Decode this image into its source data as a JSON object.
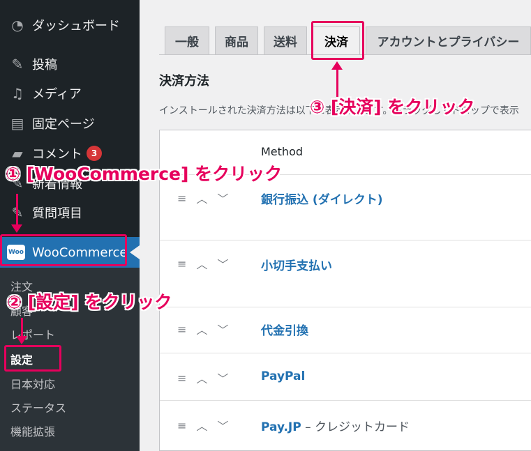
{
  "sidebar": {
    "items": [
      {
        "label": "ダッシュボード",
        "icon": "dashboard-icon"
      },
      {
        "label": "投稿",
        "icon": "pin-icon"
      },
      {
        "label": "メディア",
        "icon": "media-icon"
      },
      {
        "label": "固定ページ",
        "icon": "page-icon"
      },
      {
        "label": "コメント",
        "icon": "comment-icon",
        "badge": "3"
      },
      {
        "label": "新着情報",
        "icon": "pin-icon"
      },
      {
        "label": "質問項目",
        "icon": "pin-icon"
      }
    ],
    "woocommerce": {
      "label": "WooCommerce",
      "logo": "Woo"
    },
    "submenu": [
      "注文",
      "顧客",
      "レポート",
      "設定",
      "日本対応",
      "ステータス",
      "機能拡張"
    ]
  },
  "tabs": [
    "一般",
    "商品",
    "送料",
    "決済",
    "アカウントとプライバシー"
  ],
  "section": {
    "title": "決済方法",
    "desc": "インストールされた決済方法は以下に表示されます。ドラッグしてドロップで表示"
  },
  "table": {
    "header_method": "Method",
    "rows": [
      {
        "name": "銀行振込 (ダイレクト)",
        "suffix": ""
      },
      {
        "name": "小切手支払い",
        "suffix": ""
      },
      {
        "name": "代金引換",
        "suffix": ""
      },
      {
        "name": "PayPal",
        "suffix": ""
      },
      {
        "name": "Pay.JP",
        "suffix": " – クレジットカード"
      }
    ]
  },
  "annotations": {
    "step1": "① [WooCommerce] をクリック",
    "step2": "② [設定] をクリック",
    "step3": "③ [決済] をクリック"
  },
  "colors": {
    "accent": "#e6005c",
    "sidebar": "#1d2327",
    "link": "#2271b1"
  }
}
